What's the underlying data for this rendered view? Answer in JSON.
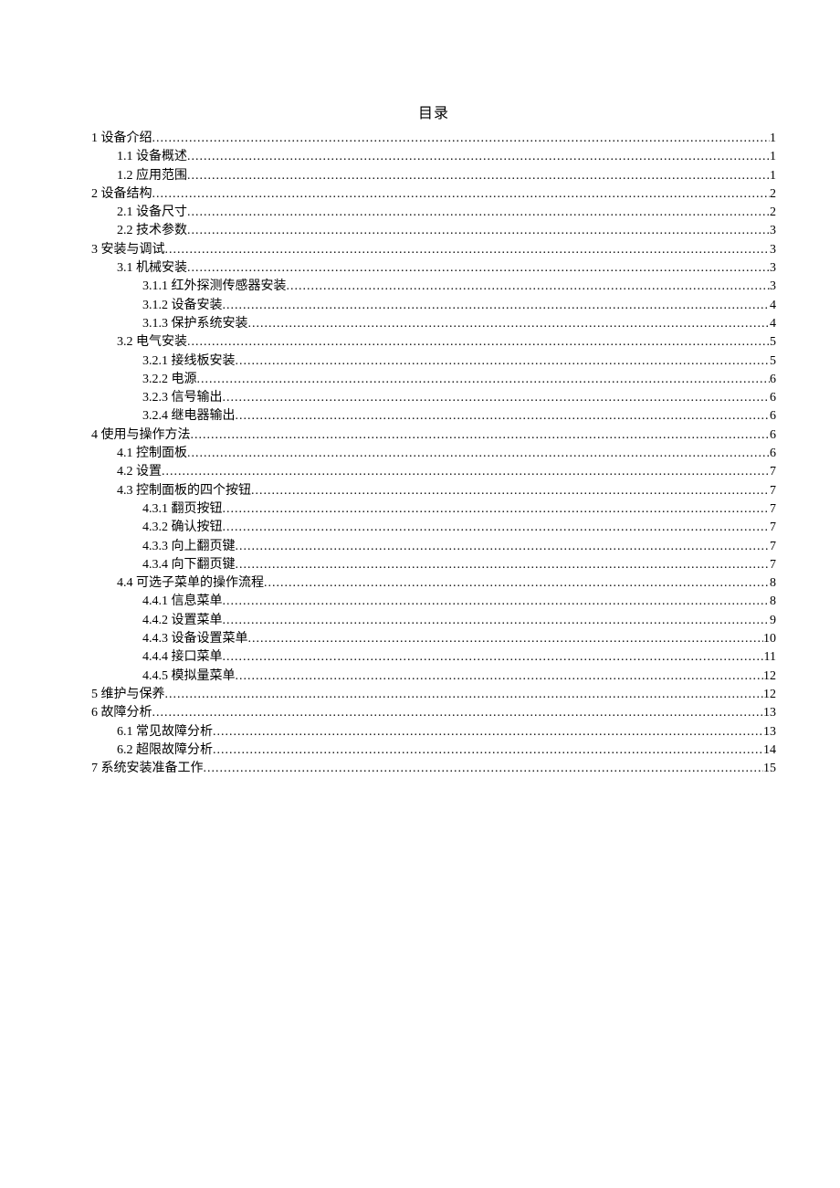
{
  "title": "目录",
  "toc": [
    {
      "level": 0,
      "label": "1 设备介绍",
      "page": "1"
    },
    {
      "level": 1,
      "label": "1.1 设备概述",
      "page": "1"
    },
    {
      "level": 1,
      "label": "1.2 应用范围",
      "page": "1"
    },
    {
      "level": 0,
      "label": "2 设备结构",
      "page": "2"
    },
    {
      "level": 1,
      "label": "2.1 设备尺寸",
      "page": "2"
    },
    {
      "level": 1,
      "label": "2.2 技术参数",
      "page": "3"
    },
    {
      "level": 0,
      "label": "3 安装与调试",
      "page": "3"
    },
    {
      "level": 1,
      "label": "3.1 机械安装",
      "page": "3"
    },
    {
      "level": 2,
      "label": "3.1.1 红外探测传感器安装",
      "page": "3"
    },
    {
      "level": 2,
      "label": "3.1.2 设备安装",
      "page": "4"
    },
    {
      "level": 2,
      "label": "3.1.3 保护系统安装",
      "page": "4"
    },
    {
      "level": 1,
      "label": "3.2 电气安装",
      "page": "5"
    },
    {
      "level": 2,
      "label": "3.2.1 接线板安装",
      "page": "5"
    },
    {
      "level": 2,
      "label": "3.2.2 电源",
      "page": "6"
    },
    {
      "level": 2,
      "label": "3.2.3 信号输出",
      "page": "6"
    },
    {
      "level": 2,
      "label": "3.2.4 继电器输出",
      "page": "6"
    },
    {
      "level": 0,
      "label": "4 使用与操作方法",
      "page": "6"
    },
    {
      "level": 1,
      "label": "4.1 控制面板",
      "page": "6"
    },
    {
      "level": 1,
      "label": "4.2 设置",
      "page": "7"
    },
    {
      "level": 1,
      "label": "4.3 控制面板的四个按钮",
      "page": "7"
    },
    {
      "level": 2,
      "label": "4.3.1 翻页按钮",
      "page": "7"
    },
    {
      "level": 2,
      "label": "4.3.2 确认按钮",
      "page": "7"
    },
    {
      "level": 2,
      "label": "4.3.3 向上翻页键",
      "page": "7"
    },
    {
      "level": 2,
      "label": "4.3.4 向下翻页键",
      "page": "7"
    },
    {
      "level": 1,
      "label": "4.4 可选子菜单的操作流程",
      "page": "8"
    },
    {
      "level": 2,
      "label": "4.4.1 信息菜单",
      "page": "8"
    },
    {
      "level": 2,
      "label": "4.4.2 设置菜单",
      "page": "9"
    },
    {
      "level": 2,
      "label": "4.4.3 设备设置菜单",
      "page": "10"
    },
    {
      "level": 2,
      "label": "4.4.4 接口菜单",
      "page": "11"
    },
    {
      "level": 2,
      "label": "4.4.5 模拟量菜单",
      "page": "12"
    },
    {
      "level": 0,
      "label": "5 维护与保养",
      "page": "12"
    },
    {
      "level": 0,
      "label": "6 故障分析",
      "page": "13"
    },
    {
      "level": 1,
      "label": "6.1 常见故障分析",
      "page": "13"
    },
    {
      "level": 1,
      "label": "6.2 超限故障分析",
      "page": "14"
    },
    {
      "level": 0,
      "label": "7 系统安装准备工作",
      "page": "15"
    }
  ]
}
